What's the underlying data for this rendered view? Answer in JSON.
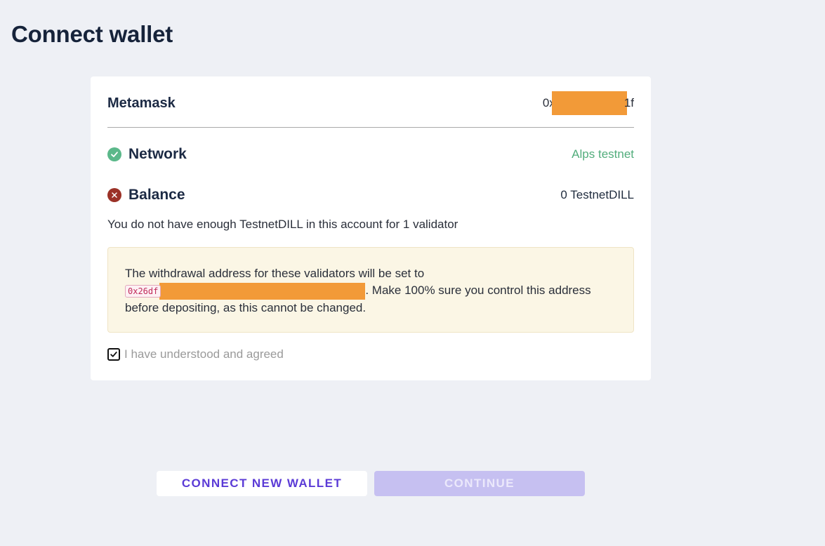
{
  "page": {
    "title": "Connect wallet"
  },
  "wallet": {
    "name": "Metamask",
    "address_prefix": "0x",
    "address_suffix": "1f"
  },
  "network": {
    "label": "Network",
    "value": "Alps testnet",
    "status": "ok"
  },
  "balance": {
    "label": "Balance",
    "value": "0 TestnetDILL",
    "status": "error"
  },
  "warning": "You do not have enough TestnetDILL in this account for 1 validator",
  "notice": {
    "line1": "The withdrawal address for these validators will be set to",
    "address_prefix": "0x26df",
    "line2": ". Make 100% sure you control this address before depositing, as this cannot be changed."
  },
  "agreement": {
    "label": "I have understood and agreed",
    "checked": true
  },
  "buttons": {
    "connect_new": "CONNECT NEW WALLET",
    "continue": "CONTINUE"
  },
  "colors": {
    "accent": "#5b3bd6",
    "success": "#5bb88a",
    "error": "#9b3127",
    "redaction": "#f29a38"
  }
}
